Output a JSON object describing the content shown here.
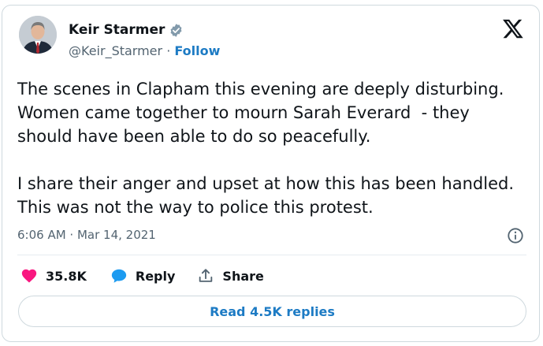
{
  "author": {
    "name": "Keir Starmer",
    "handle": "@Keir_Starmer",
    "separator": "·",
    "follow_label": "Follow"
  },
  "tweet": {
    "text": "The scenes in Clapham this evening are deeply disturbing. Women came together to mourn Sarah Everard  - they should have been able to do so peacefully.\n\nI share their anger and upset at how this has been handled. This was not the way to police this protest.",
    "timestamp": "6:06 AM · Mar 14, 2021"
  },
  "actions": {
    "likes_count": "35.8K",
    "reply_label": "Reply",
    "share_label": "Share"
  },
  "read_replies_label": "Read 4.5K replies",
  "colors": {
    "link": "#1d7bc4",
    "heart": "#f91880",
    "reply_bubble": "#1d9bf0",
    "muted": "#536471",
    "border": "#cfd9de"
  },
  "icons": [
    "verified-badge-icon",
    "x-logo-icon",
    "info-icon",
    "heart-icon",
    "reply-icon",
    "share-icon"
  ]
}
